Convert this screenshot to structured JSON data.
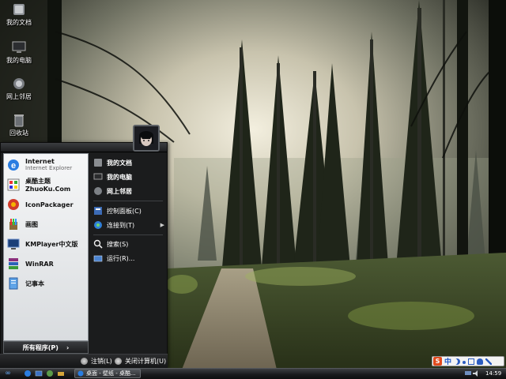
{
  "desktop": {
    "icons": [
      {
        "label": "我的文档",
        "icon": "folder-icon"
      },
      {
        "label": "我的电脑",
        "icon": "monitor-icon"
      },
      {
        "label": "网上邻居",
        "icon": "network-icon"
      },
      {
        "label": "回收站",
        "icon": "recycle-bin-icon"
      }
    ]
  },
  "start_menu": {
    "pinned": [
      {
        "title": "Internet",
        "subtitle": "Internet Explorer",
        "icon": "internet-explorer-icon"
      },
      {
        "title": "桌酷主题ZhuoKu.Com",
        "icon": "zhuoku-icon"
      },
      {
        "title": "IconPackager",
        "icon": "iconpackager-icon"
      },
      {
        "title": "画图",
        "icon": "paint-icon"
      },
      {
        "title": "KMPlayer中文版",
        "icon": "kmplayer-icon"
      },
      {
        "title": "WinRAR",
        "icon": "winrar-icon"
      },
      {
        "title": "记事本",
        "icon": "notepad-icon"
      }
    ],
    "all_programs": "所有程序(P)",
    "right": {
      "group1": [
        {
          "label": "我的文档",
          "icon": "documents-icon"
        },
        {
          "label": "我的电脑",
          "icon": "computer-icon"
        },
        {
          "label": "网上邻居",
          "icon": "network-places-icon"
        }
      ],
      "group2": [
        {
          "label": "控制面板(C)",
          "icon": "control-panel-icon"
        },
        {
          "label": "连接到(T)",
          "icon": "connect-to-icon",
          "has_submenu": true
        }
      ],
      "group3": [
        {
          "label": "搜索(S)",
          "icon": "search-icon"
        },
        {
          "label": "运行(R)...",
          "icon": "run-icon"
        }
      ]
    },
    "footer": {
      "logoff": "注销(L)",
      "shutdown": "关闭计算机(U)"
    }
  },
  "taskbar": {
    "start_glyph": "∞",
    "task_label": "桌面 - 壁纸 - 桌酷...",
    "clock": "14:59"
  },
  "ime": {
    "logo": "S",
    "mode": "中"
  },
  "colors": {
    "menu_bg": "#1b1c1d",
    "left_pane": "#eef0f2",
    "ime_logo": "#e24a1d"
  }
}
